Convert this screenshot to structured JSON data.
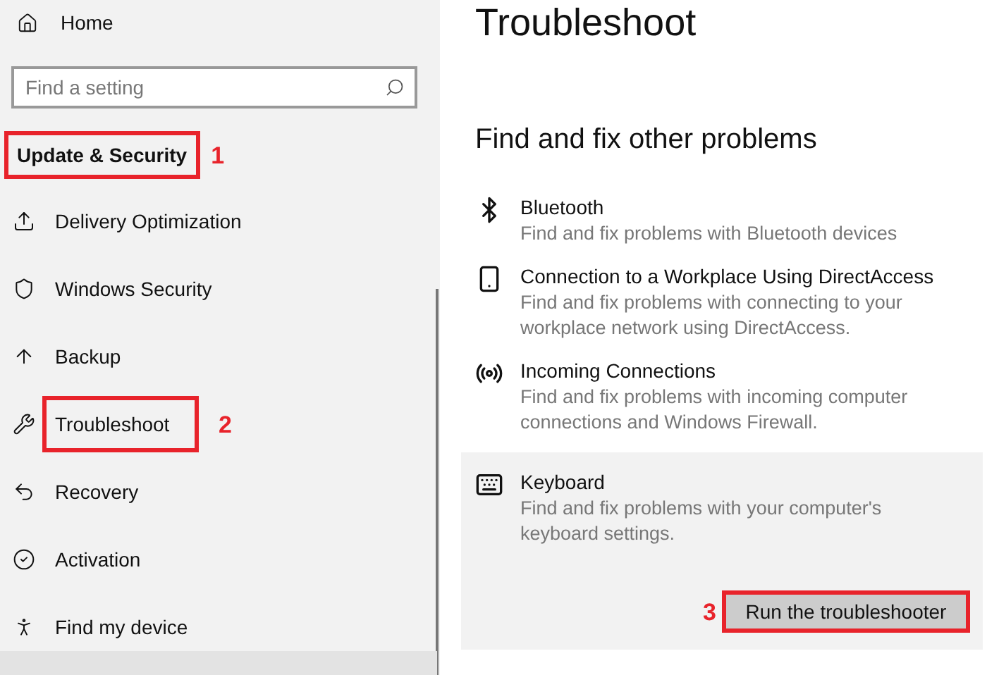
{
  "sidebar": {
    "home": {
      "label": "Home"
    },
    "search": {
      "placeholder": "Find a setting"
    },
    "section": {
      "label": "Update & Security",
      "highlighted": true,
      "step": "1"
    },
    "items": [
      {
        "label": "Delivery Optimization",
        "highlighted": false
      },
      {
        "label": "Windows Security",
        "highlighted": false
      },
      {
        "label": "Backup",
        "highlighted": false
      },
      {
        "label": "Troubleshoot",
        "highlighted": true,
        "step": "2"
      },
      {
        "label": "Recovery",
        "highlighted": false
      },
      {
        "label": "Activation",
        "highlighted": false
      },
      {
        "label": "Find my device",
        "highlighted": false
      }
    ]
  },
  "main": {
    "title": "Troubleshoot",
    "heading": "Find and fix other problems",
    "troubleshooters": [
      {
        "title": "Bluetooth",
        "description": "Find and fix problems with Bluetooth devices",
        "expanded": false
      },
      {
        "title": "Connection to a Workplace Using DirectAccess",
        "description": "Find and fix problems with connecting to your workplace network using DirectAccess.",
        "expanded": false
      },
      {
        "title": "Incoming Connections",
        "description": "Find and fix problems with incoming computer connections and Windows Firewall.",
        "expanded": false
      },
      {
        "title": "Keyboard",
        "description": "Find and fix problems with your computer's keyboard settings.",
        "expanded": true,
        "button": {
          "label": "Run the troubleshooter",
          "highlighted": true,
          "step": "3"
        }
      }
    ]
  }
}
